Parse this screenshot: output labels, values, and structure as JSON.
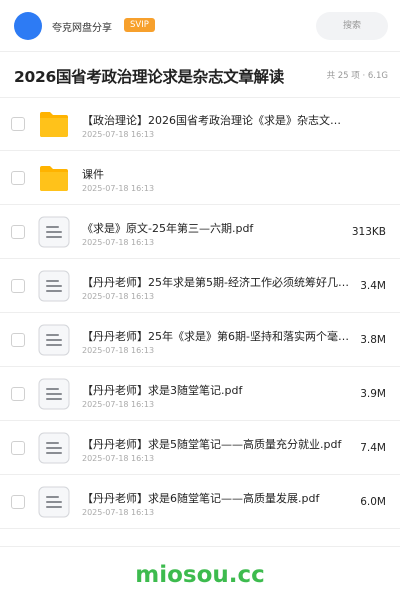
{
  "topbar": {
    "share_name": "夸克网盘分享",
    "vip_badge": "SVIP",
    "search_placeholder": "搜索",
    "avatar_color": "#2d7bf4"
  },
  "header": {
    "title": "2026国省考政治理论求是杂志文章解读",
    "meta": "共 25 项 · 6.1G"
  },
  "files": [
    {
      "type": "folder",
      "icon": "folder-icon",
      "name": "【政治理论】2026国省考政治理论《求是》杂志文章…",
      "date": "2025-07-18 16:13",
      "size": ""
    },
    {
      "type": "folder",
      "icon": "folder-icon",
      "name": "课件",
      "date": "2025-07-18 16:13",
      "size": ""
    },
    {
      "type": "file",
      "icon": "document-icon",
      "name": "《求是》原文-25年第三—六期.pdf",
      "date": "2025-07-18 16:13",
      "size": "313KB"
    },
    {
      "type": "file",
      "icon": "document-icon",
      "name": "【丹丹老师】25年求是第5期-经济工作必须统筹好几…",
      "date": "2025-07-18 16:13",
      "size": "3.4M"
    },
    {
      "type": "file",
      "icon": "document-icon",
      "name": "【丹丹老师】25年《求是》第6期-坚持和落实两个毫…",
      "date": "2025-07-18 16:13",
      "size": "3.8M"
    },
    {
      "type": "file",
      "icon": "document-icon",
      "name": "【丹丹老师】求是3随堂笔记.pdf",
      "date": "2025-07-18 16:13",
      "size": "3.9M"
    },
    {
      "type": "file",
      "icon": "document-icon",
      "name": "【丹丹老师】求是5随堂笔记——高质量充分就业.pdf",
      "date": "2025-07-18 16:13",
      "size": "7.4M"
    },
    {
      "type": "file",
      "icon": "document-icon",
      "name": "【丹丹老师】求是6随堂笔记——高质量发展.pdf",
      "date": "2025-07-18 16:13",
      "size": "6.0M"
    }
  ],
  "watermark": "miosou.cc",
  "colors": {
    "accent": "#2d7bf4",
    "vip": "#f7a02c",
    "folder": "#ffc21a",
    "watermark": "#3dbb4e"
  }
}
